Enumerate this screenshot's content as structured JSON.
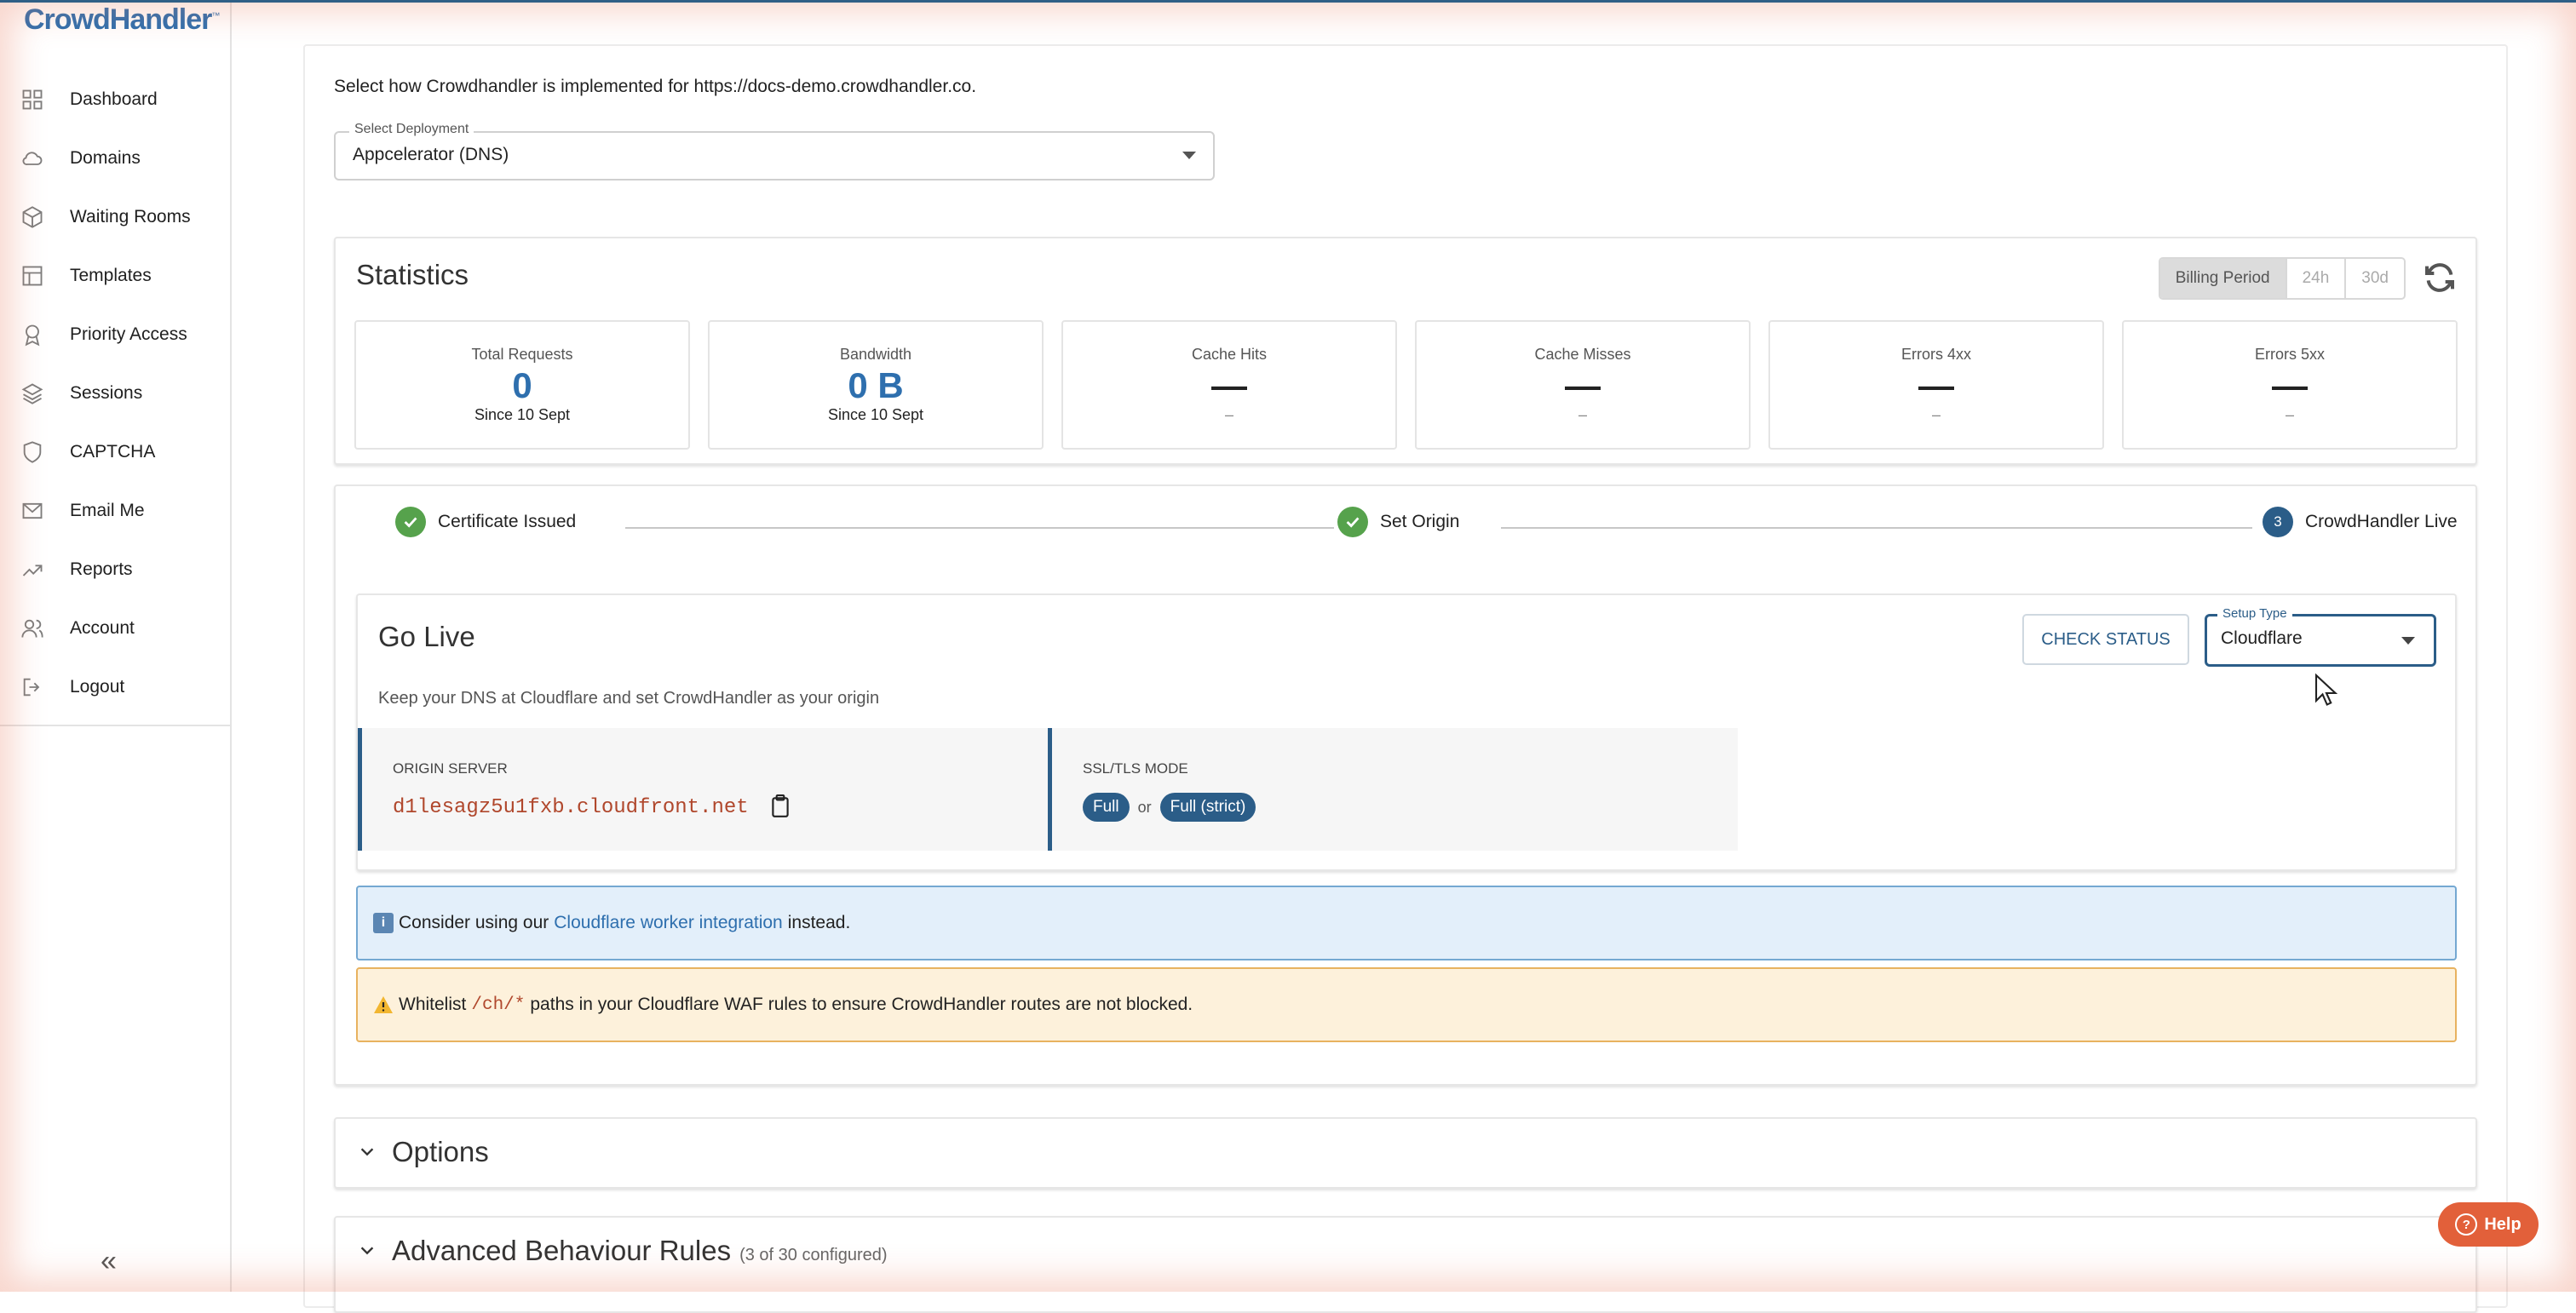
{
  "brand": {
    "name": "CrowdHandler",
    "tm": "™"
  },
  "sidebar": {
    "items": [
      {
        "label": "Dashboard",
        "icon": "grid-icon"
      },
      {
        "label": "Domains",
        "icon": "cloud-icon"
      },
      {
        "label": "Waiting Rooms",
        "icon": "cube-icon"
      },
      {
        "label": "Templates",
        "icon": "template-icon"
      },
      {
        "label": "Priority Access",
        "icon": "award-icon"
      },
      {
        "label": "Sessions",
        "icon": "layers-icon"
      },
      {
        "label": "CAPTCHA",
        "icon": "shield-icon"
      },
      {
        "label": "Email Me",
        "icon": "mail-icon"
      },
      {
        "label": "Reports",
        "icon": "trend-icon"
      },
      {
        "label": "Account",
        "icon": "users-icon"
      },
      {
        "label": "Logout",
        "icon": "logout-icon"
      }
    ],
    "collapse_label": "«"
  },
  "main": {
    "intro": "Select how Crowdhandler is implemented for https://docs-demo.crowdhandler.co.",
    "deployment": {
      "label": "Select Deployment",
      "value": "Appcelerator (DNS)"
    }
  },
  "statistics": {
    "title": "Statistics",
    "periods": [
      "Billing Period",
      "24h",
      "30d"
    ],
    "active_period": "Billing Period",
    "boxes": [
      {
        "label": "Total Requests",
        "value": "0",
        "sub": "Since 10 Sept"
      },
      {
        "label": "Bandwidth",
        "value": "0 B",
        "sub": "Since 10 Sept"
      },
      {
        "label": "Cache Hits",
        "value": "—",
        "sub": "–"
      },
      {
        "label": "Cache Misses",
        "value": "—",
        "sub": "–"
      },
      {
        "label": "Errors 4xx",
        "value": "—",
        "sub": "–"
      },
      {
        "label": "Errors 5xx",
        "value": "—",
        "sub": "–"
      }
    ]
  },
  "steps": [
    {
      "label": "Certificate Issued",
      "state": "done"
    },
    {
      "label": "Set Origin",
      "state": "done"
    },
    {
      "label": "CrowdHandler Live",
      "state": "current",
      "number": "3"
    }
  ],
  "golive": {
    "title": "Go Live",
    "check_button": "CHECK STATUS",
    "setup_type": {
      "label": "Setup Type",
      "value": "Cloudflare"
    },
    "description": "Keep your DNS at Cloudflare and set CrowdHandler as your origin",
    "origin_server": {
      "heading": "ORIGIN SERVER",
      "value": "d1lesagz5u1fxb.cloudfront.net"
    },
    "ssl": {
      "heading": "SSL/TLS MODE",
      "option_a": "Full",
      "separator": "or",
      "option_b": "Full (strict)"
    }
  },
  "alerts": {
    "info": {
      "prefix": "Consider using our",
      "link": "Cloudflare worker integration",
      "suffix": "instead."
    },
    "warning": {
      "prefix": "Whitelist",
      "code": "/ch/*",
      "suffix": "paths in your Cloudflare WAF rules to ensure CrowdHandler routes are not blocked."
    }
  },
  "accordions": {
    "options": {
      "title": "Options"
    },
    "advanced": {
      "title": "Advanced Behaviour Rules",
      "sub": "(3 of 30 configured)"
    }
  },
  "help": {
    "label": "Help"
  },
  "colors": {
    "brand": "#2e6fae",
    "primary": "#2b5d88",
    "success": "#56a24c",
    "help": "#e2603a",
    "origin_text": "#b0472c"
  }
}
